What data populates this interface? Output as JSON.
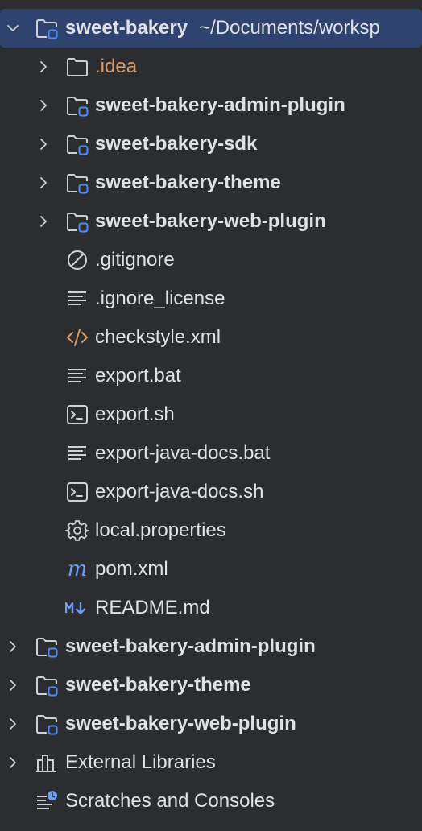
{
  "tree": {
    "root": {
      "label": "sweet-bakery",
      "path": "~/Documents/worksp",
      "icon": "module-folder-icon",
      "expanded": true
    },
    "children": [
      {
        "label": ".idea",
        "icon": "folder-icon",
        "kind": "folder",
        "expandable": true,
        "color": "#d79a6a"
      },
      {
        "label": "sweet-bakery-admin-plugin",
        "icon": "module-folder-icon",
        "kind": "module",
        "expandable": true
      },
      {
        "label": "sweet-bakery-sdk",
        "icon": "module-folder-icon",
        "kind": "module",
        "expandable": true
      },
      {
        "label": "sweet-bakery-theme",
        "icon": "module-folder-icon",
        "kind": "module",
        "expandable": true
      },
      {
        "label": "sweet-bakery-web-plugin",
        "icon": "module-folder-icon",
        "kind": "module",
        "expandable": true
      },
      {
        "label": ".gitignore",
        "icon": "ignored-file-icon",
        "kind": "file"
      },
      {
        "label": ".ignore_license",
        "icon": "text-file-icon",
        "kind": "file"
      },
      {
        "label": "checkstyle.xml",
        "icon": "xml-file-icon",
        "kind": "file"
      },
      {
        "label": "export.bat",
        "icon": "text-file-icon",
        "kind": "file"
      },
      {
        "label": "export.sh",
        "icon": "shell-script-icon",
        "kind": "file"
      },
      {
        "label": "export-java-docs.bat",
        "icon": "text-file-icon",
        "kind": "file"
      },
      {
        "label": "export-java-docs.sh",
        "icon": "shell-script-icon",
        "kind": "file"
      },
      {
        "label": "local.properties",
        "icon": "gear-icon",
        "kind": "file"
      },
      {
        "label": "pom.xml",
        "icon": "maven-icon",
        "kind": "file"
      },
      {
        "label": "README.md",
        "icon": "markdown-icon",
        "kind": "file"
      }
    ],
    "top_level": [
      {
        "label": "sweet-bakery-admin-plugin",
        "icon": "module-folder-icon",
        "expandable": true
      },
      {
        "label": "sweet-bakery-theme",
        "icon": "module-folder-icon",
        "expandable": true
      },
      {
        "label": "sweet-bakery-web-plugin",
        "icon": "module-folder-icon",
        "expandable": true
      },
      {
        "label": "External Libraries",
        "icon": "library-icon",
        "expandable": true
      },
      {
        "label": "Scratches and Consoles",
        "icon": "scratches-icon",
        "expandable": false
      }
    ],
    "colors": {
      "background": "#2b2d30",
      "selection": "#2e436e",
      "text": "#dfe1e5",
      "icon": "#ced0d6",
      "module_badge": "#548af7",
      "xml": "#d79a6a",
      "maven": "#6e9ff7"
    }
  }
}
